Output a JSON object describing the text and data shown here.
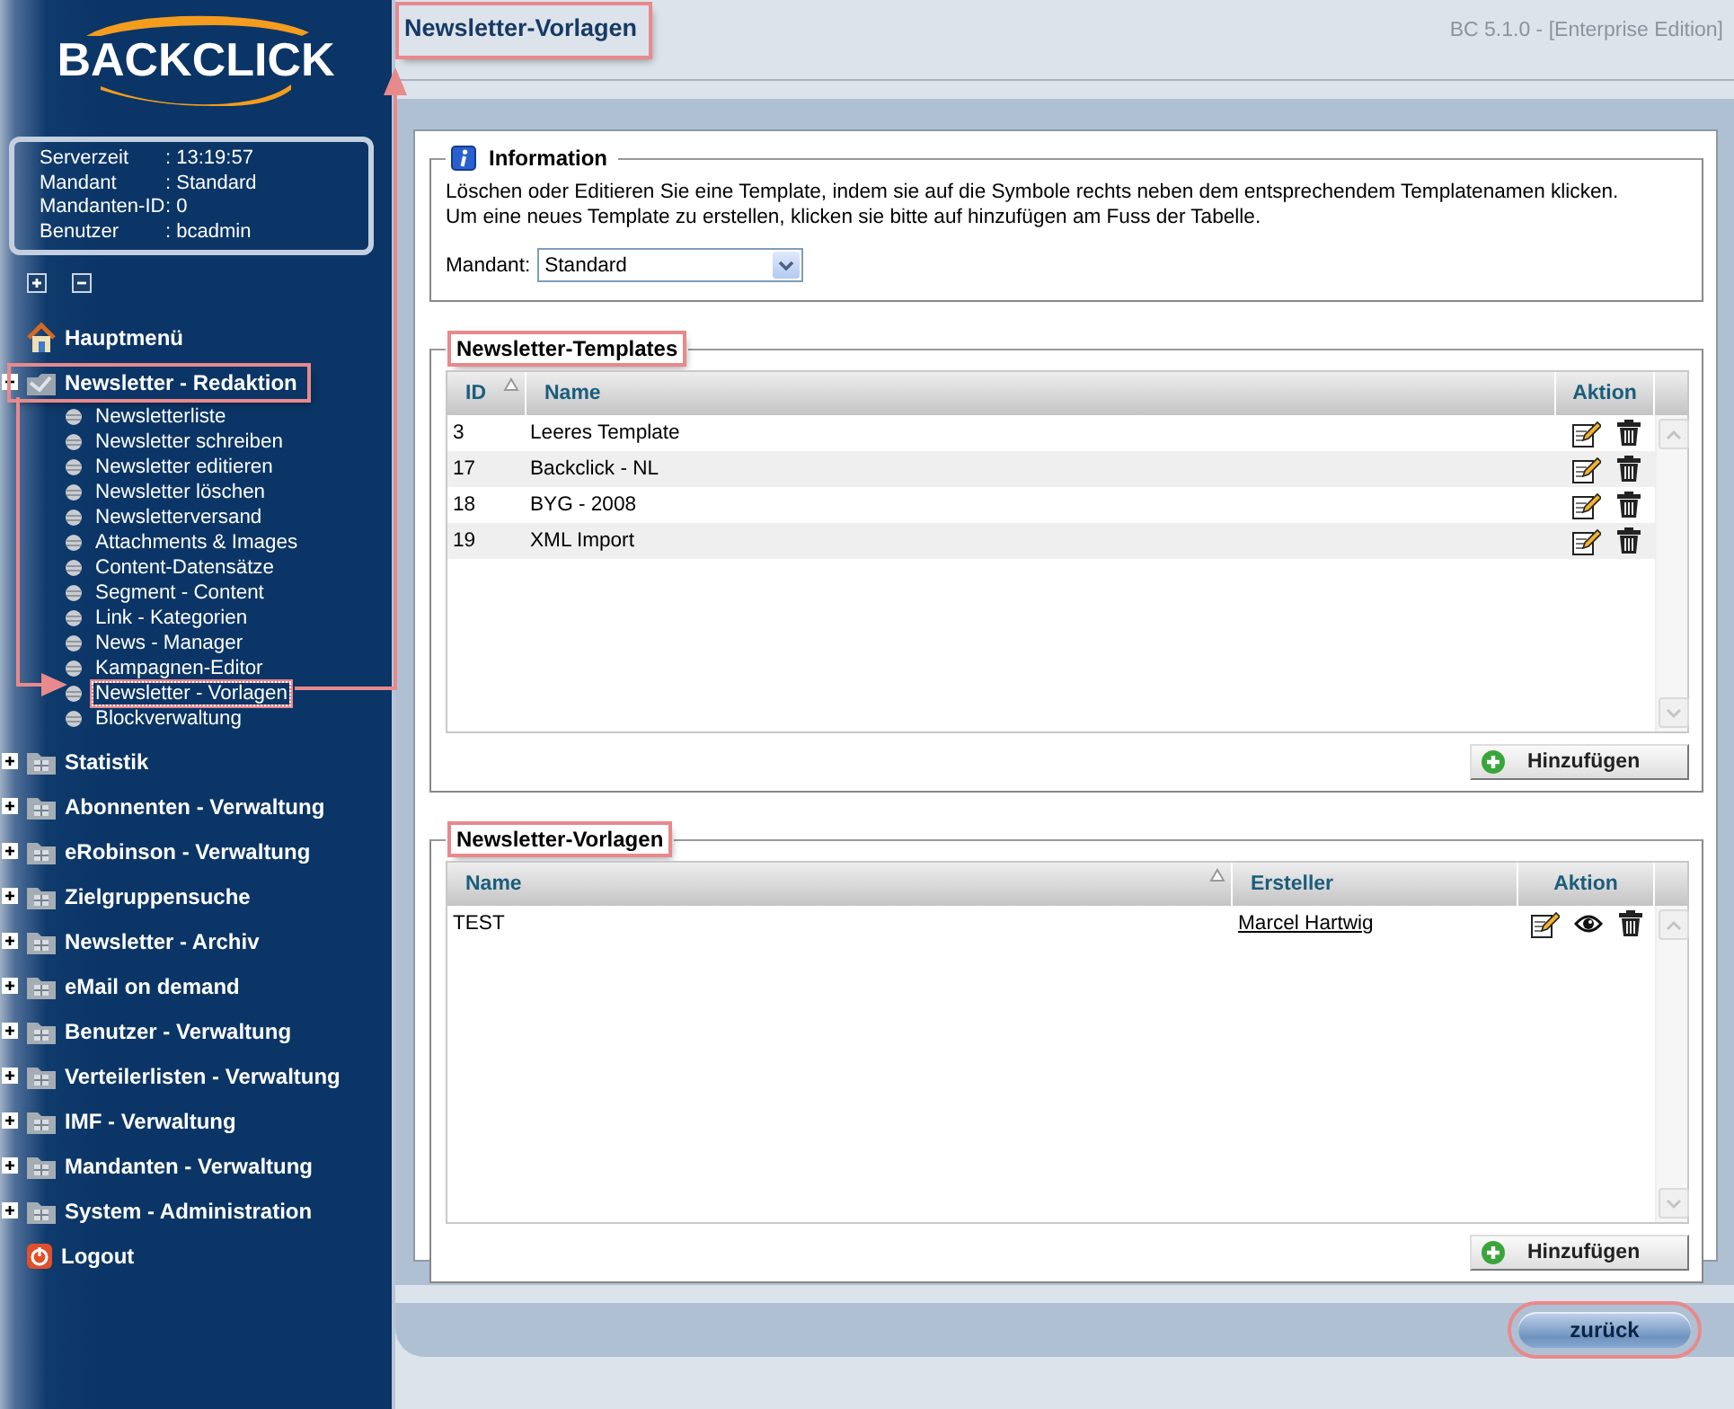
{
  "sidebar": {
    "logo": "BACKCLICK",
    "info": [
      {
        "label": "Serverzeit",
        "value": ": 13:19:57"
      },
      {
        "label": "Mandant",
        "value": ": Standard"
      },
      {
        "label": "Mandanten-ID",
        "value": ": 0"
      },
      {
        "label": "Benutzer",
        "value": ": bcadmin"
      }
    ],
    "menu": [
      {
        "kind": "home",
        "label": "Hauptmenü",
        "highlighted": false
      },
      {
        "kind": "folder",
        "label": "Newsletter - Redaktion",
        "expanded": true,
        "highlighted": true,
        "children": [
          {
            "label": "Newsletterliste",
            "selected": false
          },
          {
            "label": "Newsletter schreiben",
            "selected": false
          },
          {
            "label": "Newsletter editieren",
            "selected": false
          },
          {
            "label": "Newsletter löschen",
            "selected": false
          },
          {
            "label": "Newsletterversand",
            "selected": false
          },
          {
            "label": "Attachments & Images",
            "selected": false
          },
          {
            "label": "Content-Datensätze",
            "selected": false
          },
          {
            "label": "Segment - Content",
            "selected": false
          },
          {
            "label": "Link - Kategorien",
            "selected": false
          },
          {
            "label": "News - Manager",
            "selected": false
          },
          {
            "label": "Kampagnen-Editor",
            "selected": false
          },
          {
            "label": "Newsletter - Vorlagen",
            "selected": true
          },
          {
            "label": "Blockverwaltung",
            "selected": false
          }
        ]
      },
      {
        "kind": "folder",
        "label": "Statistik",
        "expanded": false,
        "highlighted": false
      },
      {
        "kind": "folder",
        "label": "Abonnenten - Verwaltung",
        "expanded": false,
        "highlighted": false
      },
      {
        "kind": "folder",
        "label": "eRobinson - Verwaltung",
        "expanded": false,
        "highlighted": false
      },
      {
        "kind": "folder",
        "label": "Zielgruppensuche",
        "expanded": false,
        "highlighted": false
      },
      {
        "kind": "folder",
        "label": "Newsletter - Archiv",
        "expanded": false,
        "highlighted": false
      },
      {
        "kind": "folder",
        "label": "eMail on demand",
        "expanded": false,
        "highlighted": false
      },
      {
        "kind": "folder",
        "label": "Benutzer - Verwaltung",
        "expanded": false,
        "highlighted": false
      },
      {
        "kind": "folder",
        "label": "Verteilerlisten - Verwaltung",
        "expanded": false,
        "highlighted": false
      },
      {
        "kind": "folder",
        "label": "IMF - Verwaltung",
        "expanded": false,
        "highlighted": false
      },
      {
        "kind": "folder",
        "label": "Mandanten - Verwaltung",
        "expanded": false,
        "highlighted": false
      },
      {
        "kind": "folder",
        "label": "System - Administration",
        "expanded": false,
        "highlighted": false
      },
      {
        "kind": "logout",
        "label": "Logout",
        "highlighted": false
      }
    ]
  },
  "header": {
    "title": "Newsletter-Vorlagen",
    "highlighted": true,
    "version": "BC 5.1.0 - [Enterprise Edition]"
  },
  "information": {
    "legend": "Information",
    "text": [
      "Löschen oder Editieren Sie eine Template, indem sie auf die Symbole rechts neben dem entsprechendem Templatenamen klicken.",
      "Um eine neues Template zu erstellen, klicken sie bitte auf hinzufügen am Fuss der Tabelle."
    ],
    "mandant_label": "Mandant:",
    "mandant_value": "Standard"
  },
  "tables": [
    {
      "kind": "templates",
      "legend": "Newsletter-Templates",
      "highlighted": true,
      "columns": [
        {
          "label": "ID",
          "sorted": true
        },
        {
          "label": "Name",
          "sorted": false
        },
        {
          "label": "Aktion",
          "sorted": false
        }
      ],
      "rows": [
        {
          "cells": [
            {
              "text": "3"
            },
            {
              "text": "Leeres Template"
            }
          ],
          "actions": [
            {
              "kind": "edit"
            },
            {
              "kind": "delete"
            }
          ]
        },
        {
          "cells": [
            {
              "text": "17"
            },
            {
              "text": "Backclick - NL"
            }
          ],
          "actions": [
            {
              "kind": "edit"
            },
            {
              "kind": "delete"
            }
          ]
        },
        {
          "cells": [
            {
              "text": "18"
            },
            {
              "text": "BYG - 2008"
            }
          ],
          "actions": [
            {
              "kind": "edit"
            },
            {
              "kind": "delete"
            }
          ]
        },
        {
          "cells": [
            {
              "text": "19"
            },
            {
              "text": "XML Import"
            }
          ],
          "actions": [
            {
              "kind": "edit"
            },
            {
              "kind": "delete"
            }
          ]
        }
      ],
      "add_button": "Hinzufügen"
    },
    {
      "kind": "vorlagen",
      "legend": "Newsletter-Vorlagen",
      "highlighted": true,
      "columns": [
        {
          "label": "Name",
          "sorted": true
        },
        {
          "label": "Ersteller",
          "sorted": false
        },
        {
          "label": "Aktion",
          "sorted": false
        }
      ],
      "rows": [
        {
          "cells": [
            {
              "text": "TEST"
            },
            {
              "text": "Marcel Hartwig",
              "link": true
            }
          ],
          "actions": [
            {
              "kind": "edit"
            },
            {
              "kind": "view"
            },
            {
              "kind": "delete"
            }
          ]
        }
      ],
      "add_button": "Hinzufügen"
    }
  ],
  "back_button": {
    "label": "zurück",
    "highlighted": true
  }
}
